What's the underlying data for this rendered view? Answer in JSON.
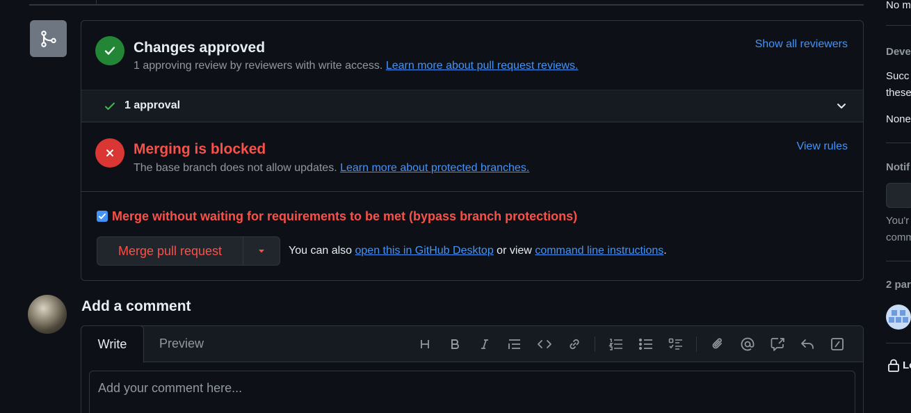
{
  "approved": {
    "title": "Changes approved",
    "subtitle": "1 approving review by reviewers with write access.",
    "link": "Learn more about pull request reviews.",
    "action": "Show all reviewers",
    "approvals_label": "1 approval"
  },
  "blocked": {
    "title": "Merging is blocked",
    "subtitle": "The base branch does not allow updates.",
    "link": "Learn more about protected branches.",
    "action": "View rules"
  },
  "merge": {
    "bypass_label": "Merge without waiting for requirements to be met (bypass branch protections)",
    "bypass_checked": true,
    "button_label": "Merge pull request",
    "help_prefix": "You can also",
    "help_link1": "open this in GitHub Desktop",
    "help_middle": "or view",
    "help_link2": "command line instructions",
    "help_suffix": "."
  },
  "comment": {
    "title": "Add a comment",
    "tab_write": "Write",
    "tab_preview": "Preview",
    "placeholder": "Add your comment here...",
    "toolbar_icons": [
      "heading-icon",
      "bold-icon",
      "italic-icon",
      "quote-icon",
      "code-icon",
      "link-icon",
      "ordered-list-icon",
      "unordered-list-icon",
      "task-list-icon",
      "attach-icon",
      "mention-icon",
      "cross-reference-icon",
      "reply-icon",
      "slash-commands-icon"
    ]
  },
  "sidebar": {
    "t1": "No m",
    "t2": "Deve",
    "t3": "Succ",
    "t4": "these",
    "t5": "None",
    "t6": "Notif",
    "t7": "You'r",
    "t8": "comm",
    "t9": "2 par",
    "t10": "Lo"
  },
  "colors": {
    "background": "#0d1117",
    "success": "#3fb950",
    "success_bg": "#238636",
    "danger": "#f85149",
    "danger_bg": "#da3633",
    "link": "#4493f8",
    "muted": "#9198a1"
  }
}
